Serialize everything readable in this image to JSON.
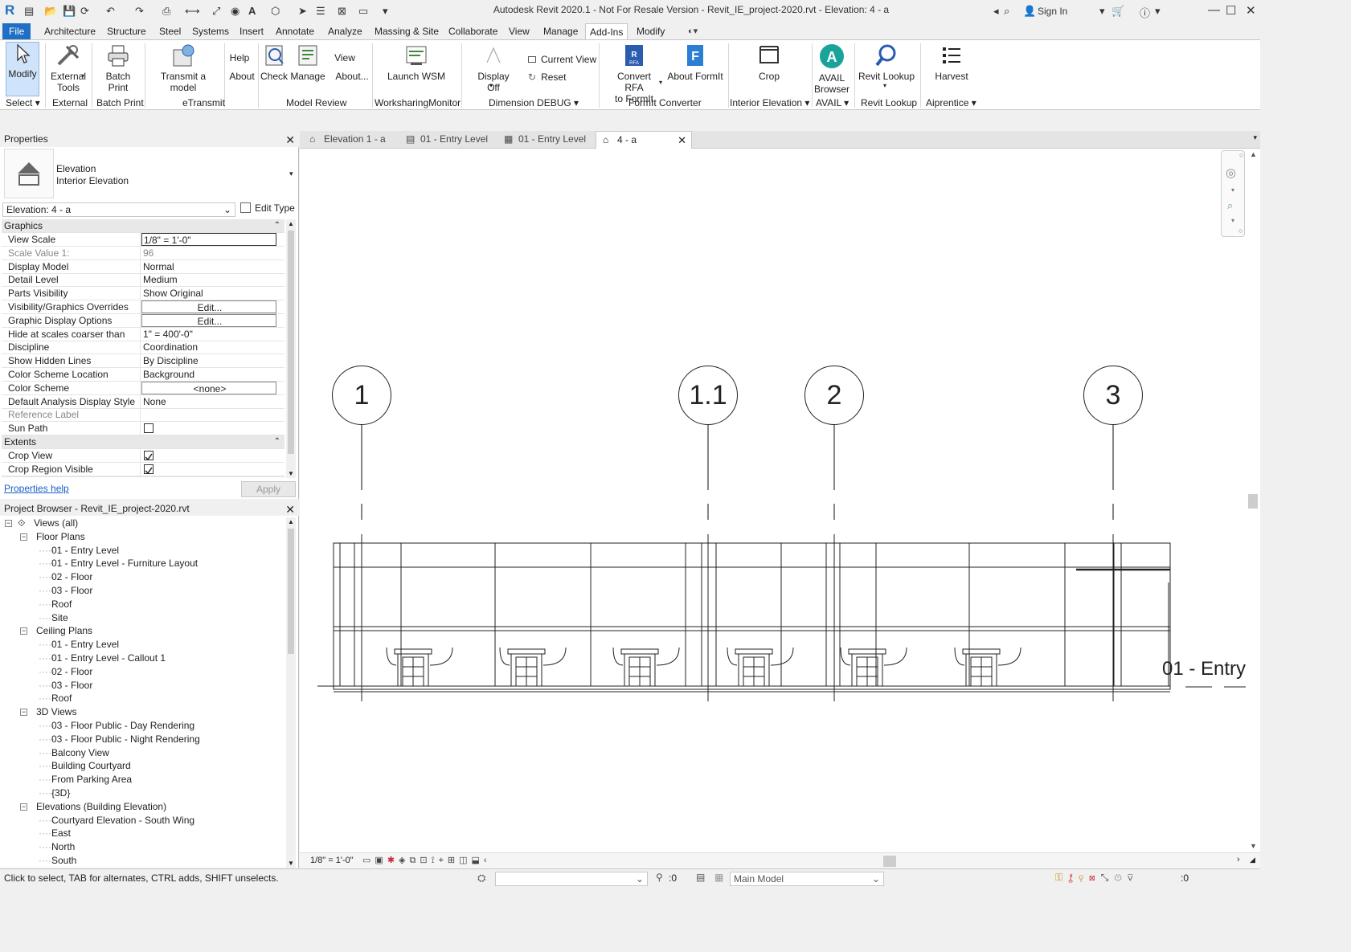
{
  "titlebar": {
    "title": "Autodesk Revit 2020.1 - Not For Resale Version - Revit_IE_project-2020.rvt - Elevation: 4 - a",
    "sign_in": "Sign In"
  },
  "menu": [
    "File",
    "Architecture",
    "Structure",
    "Steel",
    "Systems",
    "Insert",
    "Annotate",
    "Analyze",
    "Massing & Site",
    "Collaborate",
    "View",
    "Manage",
    "Add-Ins",
    "Modify"
  ],
  "ribbon": {
    "buttons": {
      "modify": "Modify",
      "external_tools_1": "External",
      "external_tools_2": "Tools",
      "batch_print": "Batch Print",
      "transmit": "Transmit a model",
      "help": "Help",
      "about": "About",
      "check": "Check",
      "manage": "Manage",
      "view": "View",
      "about_dots": "About...",
      "launch_wsm": "Launch WSM",
      "display_off": "Display Off",
      "current_view": "Current View",
      "reset": "Reset",
      "convert_1": "Convert RFA",
      "convert_2": "to FormIt",
      "about_formit": "About FormIt",
      "crop": "Crop",
      "avail_1": "AVAIL",
      "avail_2": "Browser",
      "revit_lookup": "Revit Lookup",
      "harvest": "Harvest"
    },
    "panels": [
      "Select",
      "External",
      "Batch Print",
      "eTransmit",
      "Model Review",
      "WorksharingMonitor",
      "Dimension DEBUG",
      "FormIt Converter",
      "Interior Elevation",
      "AVAIL",
      "Revit Lookup",
      "Aiprentice"
    ]
  },
  "properties": {
    "header": "Properties",
    "type_line1": "Elevation",
    "type_line2": "Interior Elevation",
    "selector": "Elevation: 4 - a",
    "edit_type": "Edit Type",
    "section_graphics": "Graphics",
    "section_extents": "Extents",
    "rows": [
      {
        "k": "View Scale",
        "v": "1/8\" = 1'-0\""
      },
      {
        "k": "Scale Value    1:",
        "v": "96"
      },
      {
        "k": "Display Model",
        "v": "Normal"
      },
      {
        "k": "Detail Level",
        "v": "Medium"
      },
      {
        "k": "Parts Visibility",
        "v": "Show Original"
      },
      {
        "k": "Visibility/Graphics Overrides",
        "v": "Edit..."
      },
      {
        "k": "Graphic Display Options",
        "v": "Edit..."
      },
      {
        "k": "Hide at scales coarser than",
        "v": "1\" = 400'-0\""
      },
      {
        "k": "Discipline",
        "v": "Coordination"
      },
      {
        "k": "Show Hidden Lines",
        "v": "By Discipline"
      },
      {
        "k": "Color Scheme Location",
        "v": "Background"
      },
      {
        "k": "Color Scheme",
        "v": "<none>"
      },
      {
        "k": "Default Analysis Display Style",
        "v": "None"
      },
      {
        "k": "Reference Label",
        "v": ""
      },
      {
        "k": "Sun Path",
        "v": ""
      }
    ],
    "extents_rows": [
      {
        "k": "Crop View",
        "v": ""
      },
      {
        "k": "Crop Region Visible",
        "v": ""
      }
    ],
    "help_link": "Properties help",
    "apply": "Apply"
  },
  "browser": {
    "header": "Project Browser - Revit_IE_project-2020.rvt",
    "root": "Views (all)",
    "floor_plans": "Floor Plans",
    "floor_items": [
      "01 - Entry Level",
      "01 - Entry Level - Furniture Layout",
      "02 - Floor",
      "03 - Floor",
      "Roof",
      "Site"
    ],
    "ceiling_plans": "Ceiling Plans",
    "ceiling_items": [
      "01 - Entry Level",
      "01 - Entry Level - Callout 1",
      "02 - Floor",
      "03 - Floor",
      "Roof"
    ],
    "views_3d": "3D Views",
    "items_3d": [
      "03 - Floor Public - Day Rendering",
      "03 - Floor Public - Night Rendering",
      "Balcony View",
      "Building Courtyard",
      "From Parking Area",
      "{3D}"
    ],
    "elevations": "Elevations (Building Elevation)",
    "elevation_items": [
      "Courtyard Elevation - South Wing",
      "East",
      "North",
      "South"
    ]
  },
  "tabs": [
    "Elevation 1 - a",
    "01 - Entry Level",
    "01 - Entry Level",
    "4 - a"
  ],
  "drawing": {
    "grids": [
      "1",
      "1.1",
      "2",
      "3"
    ],
    "level": "01 - Entry"
  },
  "viewbar": {
    "scale": "1/8\" = 1'-0\""
  },
  "status": {
    "hint": "Click to select, TAB for alternates, CTRL adds, SHIFT unselects.",
    "count": ":0",
    "model": "Main Model",
    "filter": ":0"
  },
  "colors": {
    "accent": "#1f6fc5",
    "avail": "#1aa39a",
    "ribbon_blue": "#2a5db0"
  }
}
